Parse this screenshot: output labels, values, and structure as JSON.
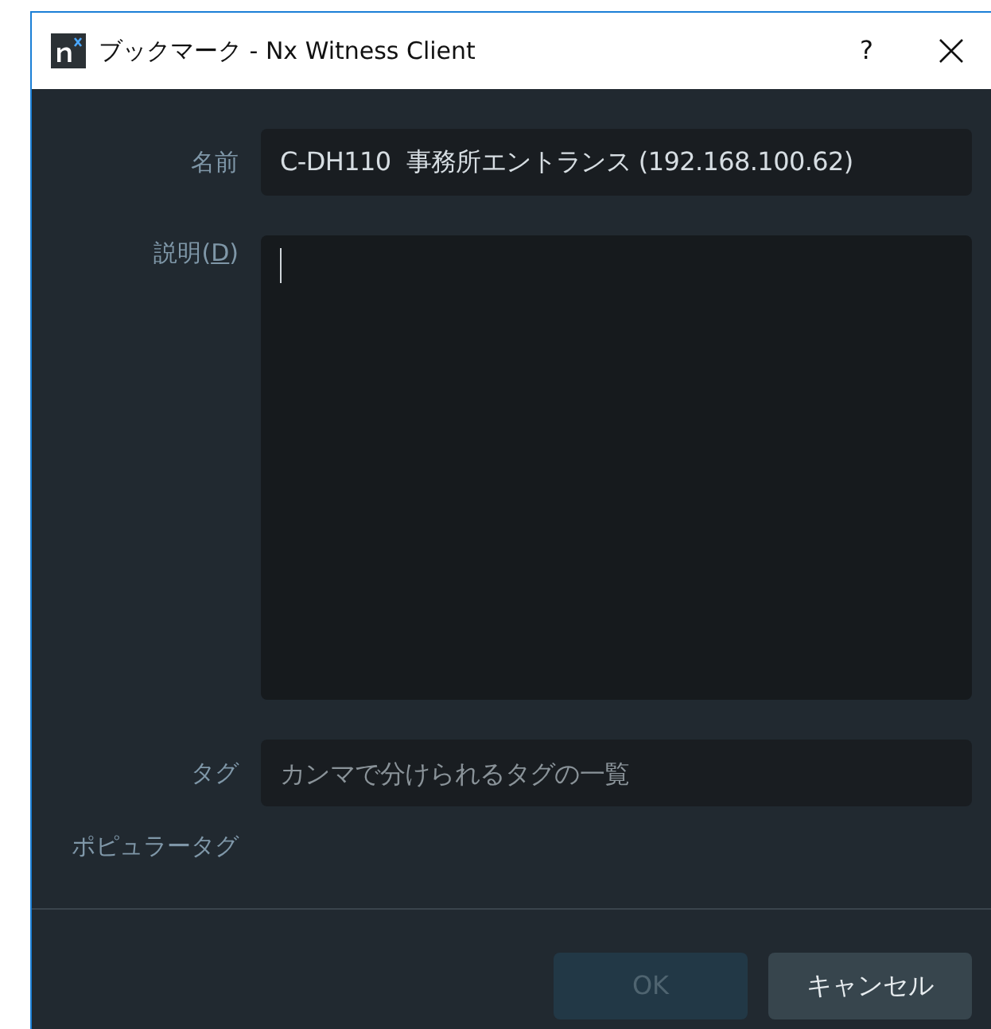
{
  "window": {
    "title": "ブックマーク - Nx Witness Client",
    "help": "?"
  },
  "fields": [
    {
      "kind": "text",
      "label": "名前",
      "value": "C-DH110  事務所エントランス (192.168.100.62)"
    },
    {
      "kind": "multiline",
      "label_prefix": "説明(",
      "mnemonic": "D",
      "label_suffix": ")",
      "focused": true
    },
    {
      "kind": "text",
      "label": "タグ",
      "placeholder": "カンマで分けられるタグの一覧"
    }
  ],
  "popular_tags_label": "ポピュラータグ",
  "buttons": [
    {
      "label": "OK",
      "disabled": true
    },
    {
      "label": "キャンセル",
      "disabled": false
    }
  ]
}
